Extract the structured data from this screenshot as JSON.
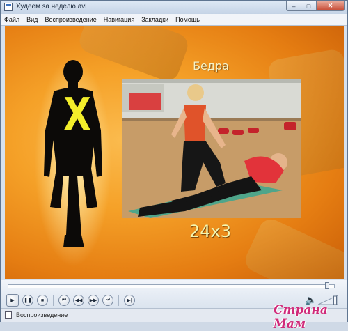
{
  "window": {
    "title": "Худеем за неделю.avi"
  },
  "caption_buttons": {
    "minimize": "–",
    "maximize": "□",
    "close": "✕"
  },
  "menu": [
    "Файл",
    "Вид",
    "Воспроизведение",
    "Навигация",
    "Закладки",
    "Помощь"
  ],
  "video": {
    "body_part_label": "Бедра",
    "reps": "24x3",
    "silhouette_letter": "X"
  },
  "playback": {
    "position": 0.985
  },
  "controls": {
    "buttons": [
      {
        "name": "play-button",
        "icon": "play-icon",
        "glyph": "▶"
      },
      {
        "name": "pause-button",
        "icon": "pause-icon",
        "glyph": "❚❚"
      },
      {
        "name": "stop-button",
        "icon": "stop-icon",
        "glyph": "■"
      },
      {
        "name": "skip-back-button",
        "icon": "skip-back-icon",
        "glyph": "⏮"
      },
      {
        "name": "rewind-button",
        "icon": "rewind-icon",
        "glyph": "◀◀"
      },
      {
        "name": "fast-forward-button",
        "icon": "fast-forward-icon",
        "glyph": "▶▶"
      },
      {
        "name": "skip-forward-button",
        "icon": "skip-forward-icon",
        "glyph": "⏭"
      },
      {
        "name": "step-button",
        "icon": "step-forward-icon",
        "glyph": "▶|"
      }
    ],
    "volume_icon": "speaker-icon",
    "volume_level": 0.9
  },
  "status": {
    "text": "Воспроизведение"
  },
  "watermark": "Страна Мам",
  "colors": {
    "accent": "#2a6fcf",
    "video_bg": "#f5a128",
    "highlight": "#f3ee2a"
  }
}
